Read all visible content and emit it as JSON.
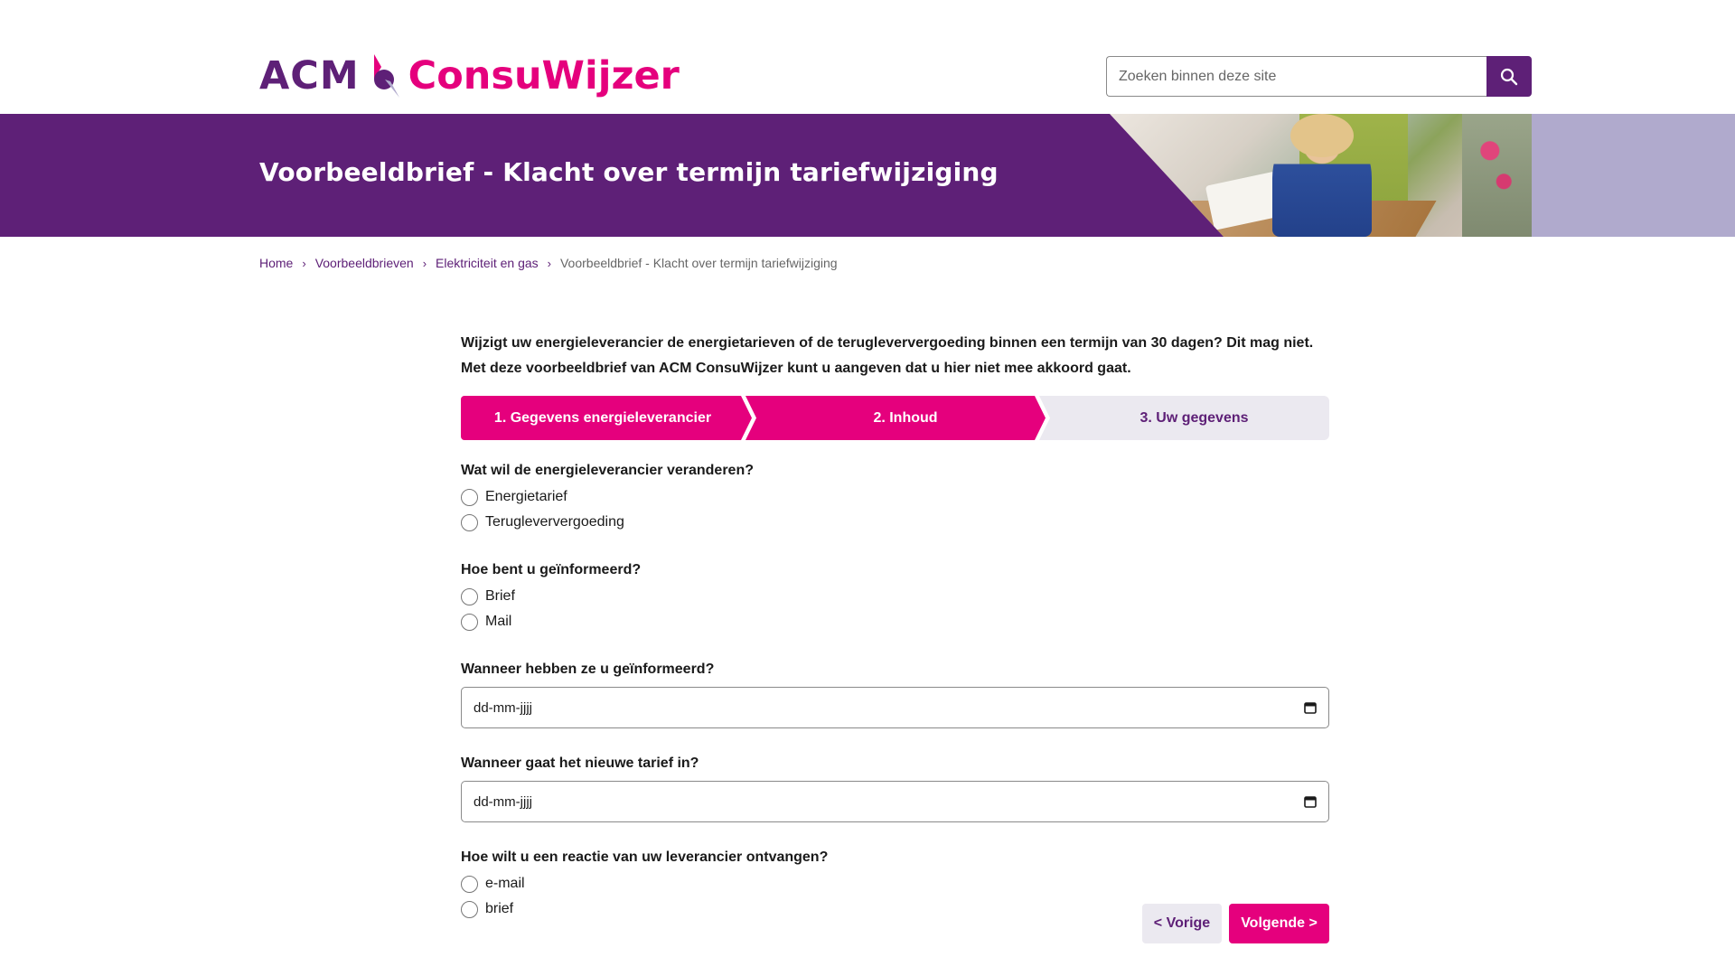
{
  "header": {
    "logo_acm": "ACM",
    "logo_consu": "ConsuWijzer",
    "search_placeholder": "Zoeken binnen deze site",
    "search_icon": "search-icon"
  },
  "banner": {
    "title": "Voorbeeldbrief - Klacht over termijn tariefwijziging"
  },
  "breadcrumb": {
    "items": [
      "Home",
      "Voorbeeldbrieven",
      "Elektriciteit en gas"
    ],
    "current": "Voorbeeldbrief - Klacht over termijn tariefwijziging",
    "separator": "›"
  },
  "intro": {
    "line1": "Wijzigt uw energieleverancier de energietarieven of de terugleververgoeding binnen een termijn van 30 dagen? Dit mag niet.",
    "line2": "Met deze voorbeeldbrief van ACM ConsuWijzer kunt u aangeven dat u hier niet mee akkoord gaat."
  },
  "steps": [
    {
      "label": "1. Gegevens energieleverancier",
      "state": "done"
    },
    {
      "label": "2. Inhoud",
      "state": "active"
    },
    {
      "label": "3. Uw gegevens",
      "state": "todo"
    }
  ],
  "form": {
    "q_change": {
      "label": "Wat wil de energieleverancier veranderen?",
      "options": [
        "Energietarief",
        "Terugleververgoeding"
      ]
    },
    "q_informed": {
      "label": "Hoe bent u geïnformeerd?",
      "options": [
        "Brief",
        "Mail"
      ]
    },
    "q_when_informed": {
      "label": "Wanneer hebben ze u geïnformeerd?",
      "placeholder": "dd-mm-jjjj"
    },
    "q_new_tariff": {
      "label": "Wanneer gaat het nieuwe tarief in?",
      "placeholder": "dd-mm-jjjj"
    },
    "q_reaction": {
      "label": "Hoe wilt u een reactie van uw leverancier ontvangen?",
      "options": [
        "e-mail",
        "brief"
      ]
    }
  },
  "buttons": {
    "prev": "< Vorige",
    "next": "Volgende >"
  },
  "colors": {
    "brand_purple": "#5e2077",
    "brand_pink": "#e5007d",
    "step_inactive": "#ebe9f0"
  }
}
